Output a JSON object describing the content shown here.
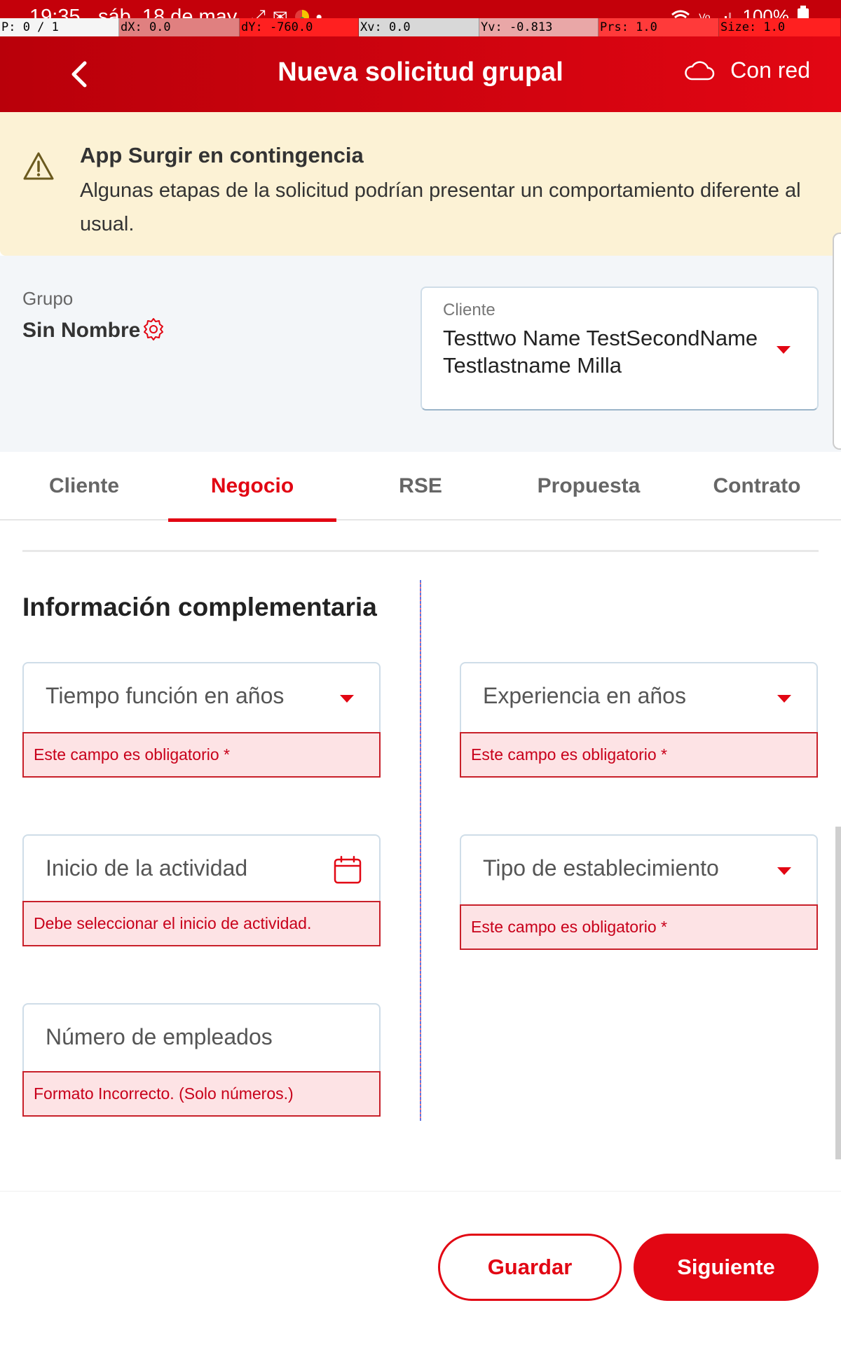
{
  "status_bar": {
    "time": "19:35",
    "date": "sáb, 18 de may",
    "battery": "100%",
    "signal_label": "Vo"
  },
  "debug_overlay": {
    "pointer": "P: 0 / 1",
    "dx": "dX: 0.0",
    "dy": "dY: -760.0",
    "xv": "Xv: 0.0",
    "yv": "Yv: -0.813",
    "prs": "Prs: 1.0",
    "size": "Size: 1.0"
  },
  "header": {
    "back_icon": "chevron-left-icon",
    "title": "Nueva solicitud grupal",
    "network_icon": "cloud-icon",
    "network_status": "Con red"
  },
  "banner": {
    "icon": "warning-icon",
    "title": "App Surgir en contingencia",
    "text": "Algunas etapas de la solicitud podrían presentar un comportamiento diferente al usual."
  },
  "group": {
    "label": "Grupo",
    "name": "Sin Nombre",
    "settings_icon": "gear-icon"
  },
  "client_select": {
    "label": "Cliente",
    "value": "Testtwo Name TestSecondName Testlastname Milla"
  },
  "tabs": [
    {
      "label": "Cliente"
    },
    {
      "label": "Negocio"
    },
    {
      "label": "RSE"
    },
    {
      "label": "Propuesta"
    },
    {
      "label": "Contrato"
    }
  ],
  "active_tab": "Negocio",
  "section": {
    "title": "Información complementaria"
  },
  "fields": {
    "tiempo_funcion": {
      "placeholder": "Tiempo función en años",
      "error": "Este campo es obligatorio *"
    },
    "experiencia": {
      "placeholder": "Experiencia en años",
      "error": "Este campo es obligatorio *"
    },
    "inicio_actividad": {
      "placeholder": "Inicio de la actividad",
      "error": "Debe seleccionar el inicio de actividad."
    },
    "tipo_establecimiento": {
      "placeholder": "Tipo de establecimiento",
      "error": "Este campo es obligatorio *"
    },
    "numero_empleados": {
      "placeholder": "Número de empleados",
      "error": "Formato Incorrecto. (Solo números.)"
    }
  },
  "actions": {
    "save": "Guardar",
    "next": "Siguiente"
  },
  "colors": {
    "brand_red": "#e20613",
    "error_bg": "#fde3e5",
    "banner_bg": "#fcf2d5"
  }
}
